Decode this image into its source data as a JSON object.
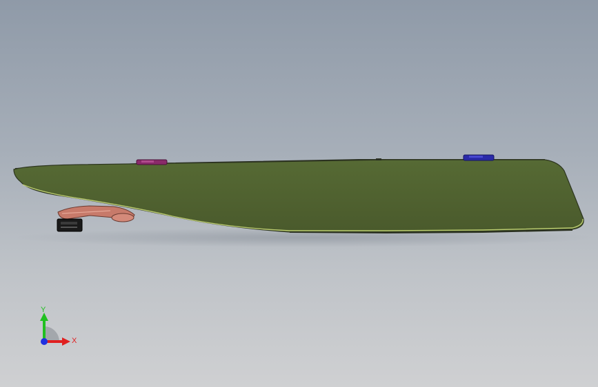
{
  "viewport": {
    "background_top": "#8f9aa8",
    "background_bottom": "#cfd0d2"
  },
  "model": {
    "panel_color": "#4f6130",
    "panel_edge_color": "#c8d878",
    "arm_color": "#c77a6a",
    "clip_left_color": "#8a2a6a",
    "clip_right_color": "#2a2aa8",
    "block_color": "#1a1a1a"
  },
  "triad": {
    "x_label": "X",
    "y_label": "Y",
    "x_color": "#e02020",
    "y_color": "#20c020",
    "z_color": "#2030e0"
  }
}
